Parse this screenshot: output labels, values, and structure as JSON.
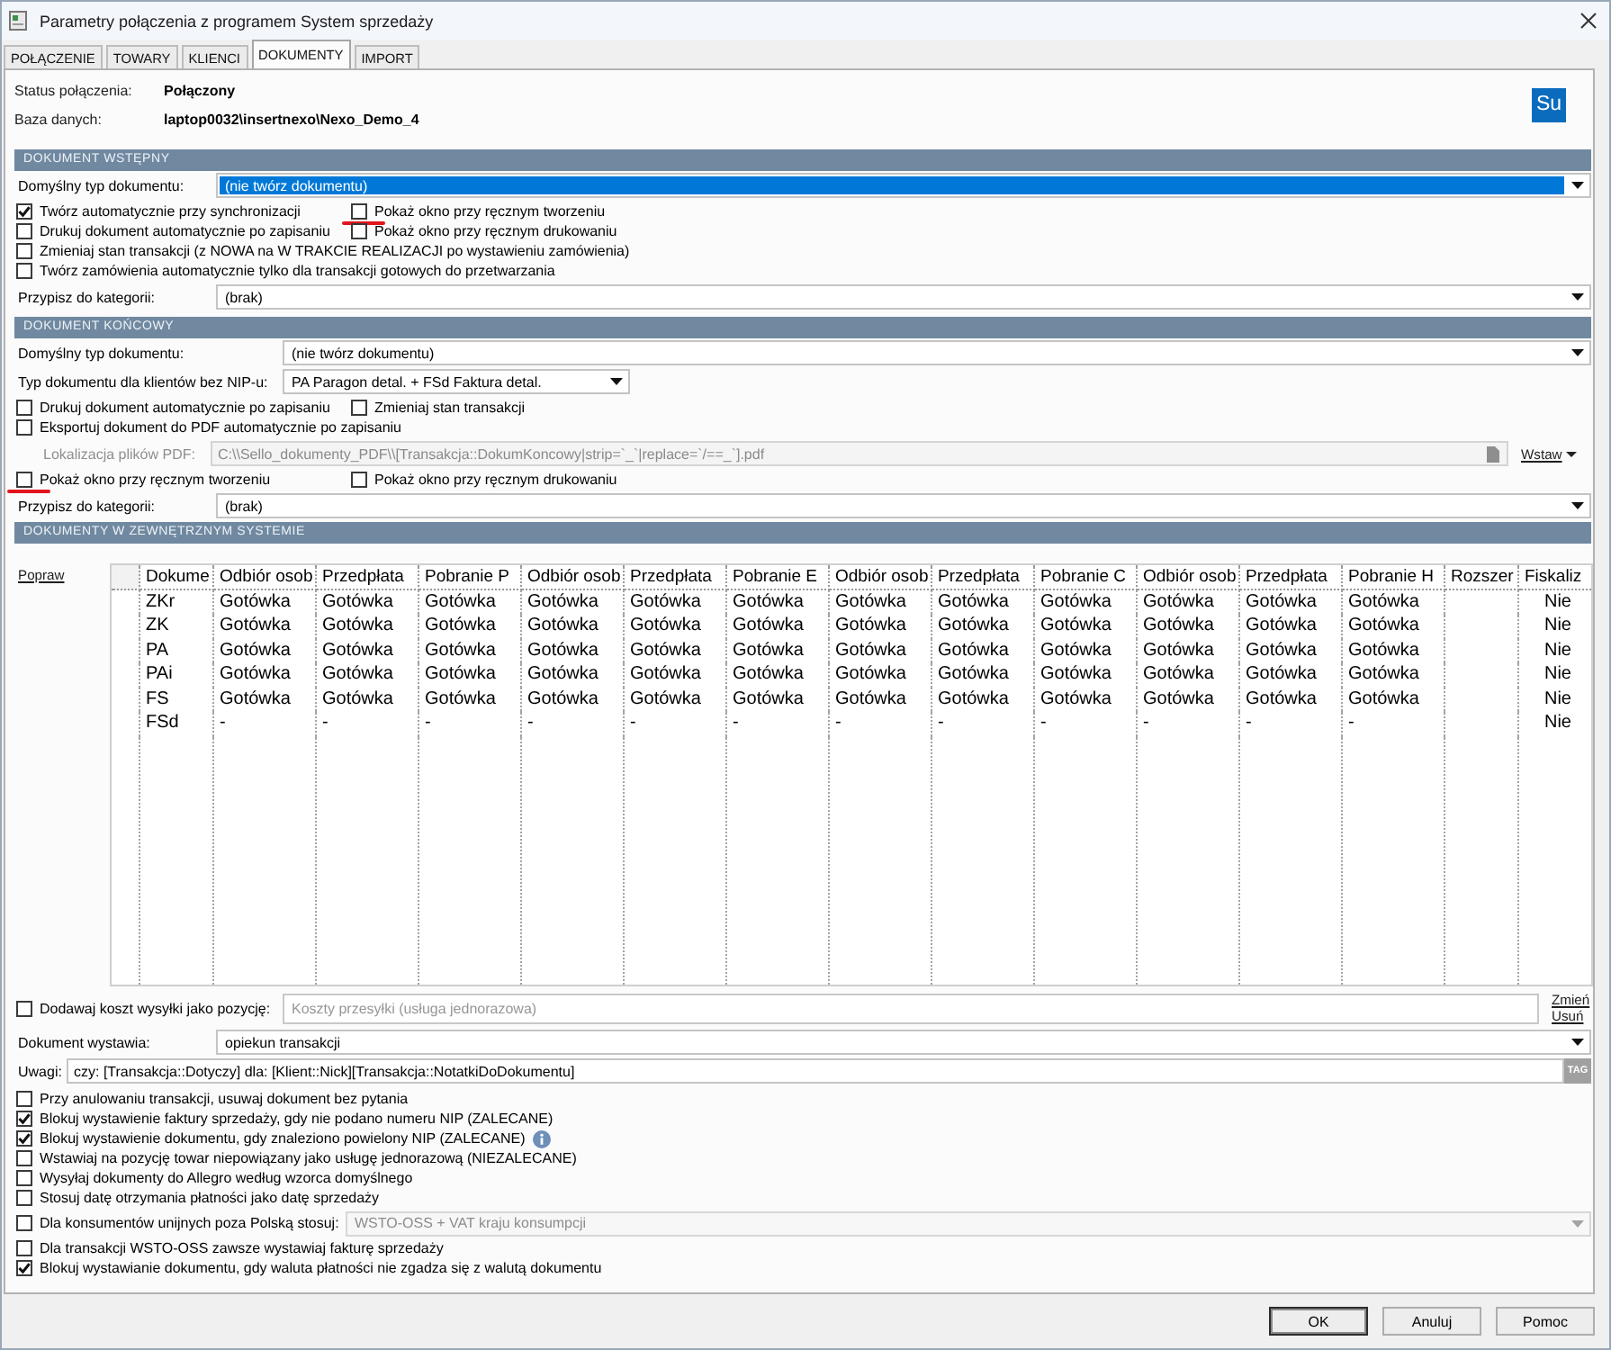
{
  "window": {
    "title": "Parametry połączenia z programem System sprzedaży"
  },
  "tabs": [
    {
      "label": "POŁĄCZENIE",
      "selected": false
    },
    {
      "label": "TOWARY",
      "selected": false
    },
    {
      "label": "KLIENCI",
      "selected": false
    },
    {
      "label": "DOKUMENTY",
      "selected": true
    },
    {
      "label": "IMPORT",
      "selected": false
    }
  ],
  "status": [
    {
      "label": "Status połączenia:",
      "value": "Połączony"
    },
    {
      "label": "Baza danych:",
      "value": "laptop0032\\insertnexo\\Nexo_Demo_4"
    }
  ],
  "logo": {
    "text": "Su"
  },
  "sections": [
    {
      "title": "DOKUMENT WSTĘPNY",
      "rows": [
        {
          "kind": "select",
          "label": "Domyślny typ dokumentu:",
          "value": "(nie twórz dokumentu)",
          "focused": true
        },
        {
          "kind": "checks",
          "items": [
            {
              "label": "Twórz automatycznie przy synchronizacji",
              "checked": true,
              "annotated": false
            },
            {
              "label": "Pokaż okno przy ręcznym tworzeniu",
              "checked": false,
              "annotated": true
            }
          ]
        },
        {
          "kind": "checks",
          "items": [
            {
              "label": "Drukuj dokument automatycznie po zapisaniu",
              "checked": false,
              "annotated": false
            },
            {
              "label": "Pokaż okno przy ręcznym drukowaniu",
              "checked": false,
              "annotated": false
            }
          ]
        },
        {
          "kind": "checks",
          "items": [
            {
              "label": "Zmieniaj stan transakcji (z NOWA na W TRAKCIE REALIZACJI po wystawieniu zamówienia)",
              "checked": false,
              "annotated": false
            }
          ]
        },
        {
          "kind": "checks",
          "items": [
            {
              "label": "Twórz zamówienia automatycznie tylko dla transakcji gotowych do przetwarzania",
              "checked": false,
              "annotated": false
            }
          ]
        },
        {
          "kind": "select",
          "label": "Przypisz do kategorii:",
          "value": "(brak)",
          "focused": false
        }
      ]
    },
    {
      "title": "DOKUMENT KOŃCOWY",
      "rows": [
        {
          "kind": "select_pair",
          "selects": [
            {
              "label": "Domyślny typ dokumentu:",
              "value": "(nie twórz dokumentu)",
              "focused": false
            },
            {
              "label": "Typ dokumentu dla klientów bez NIP-u:",
              "value": "PA Paragon detal. + FSd Faktura detal.",
              "focused": false
            }
          ]
        },
        {
          "kind": "checks",
          "items": [
            {
              "label": "Drukuj dokument automatycznie po zapisaniu",
              "checked": false,
              "annotated": false
            },
            {
              "label": "Zmieniaj stan transakcji",
              "checked": false,
              "annotated": false
            }
          ]
        },
        {
          "kind": "checks",
          "items": [
            {
              "label": "Eksportuj dokument do PDF automatycznie po zapisaniu",
              "checked": false,
              "annotated": false
            }
          ]
        },
        {
          "kind": "path",
          "label": "Lokalizacja plików PDF:",
          "value": "C:\\\\Sello_dokumenty_PDF\\\\[Transakcja::DokumKoncowy|strip=`_`|replace=`/==_`].pdf",
          "disabled": true,
          "link": "Wstaw"
        },
        {
          "kind": "checks",
          "items": [
            {
              "label": "Pokaż okno przy ręcznym tworzeniu",
              "checked": false,
              "annotated": true
            },
            {
              "label": "Pokaż okno przy ręcznym drukowaniu",
              "checked": false,
              "annotated": false
            }
          ]
        },
        {
          "kind": "select",
          "label": "Przypisz do kategorii:",
          "value": "(brak)",
          "focused": false
        }
      ]
    }
  ],
  "external_documents": {
    "title": "DOKUMENTY W ZEWNĘTRZNYM SYSTEMIE",
    "link": "Popraw",
    "table": {
      "columns": [
        "Dokume",
        "Odbiór osob",
        "Przedpłata",
        "Pobranie P",
        "Odbiór osob",
        "Przedpłata",
        "Pobranie E",
        "Odbiór osob",
        "Przedpłata",
        "Pobranie C",
        "Odbiór osob",
        "Przedpłata",
        "Pobranie H",
        "Rozszer",
        "Fiskaliz"
      ],
      "rows": [
        {
          "document": "ZKr",
          "payments": [
            "Gotówka",
            "Gotówka",
            "Gotówka",
            "Gotówka",
            "Gotówka",
            "Gotówka",
            "Gotówka",
            "Gotówka",
            "Gotówka",
            "Gotówka",
            "Gotówka",
            "Gotówka"
          ],
          "fiscal": "Nie"
        },
        {
          "document": "ZK",
          "payments": [
            "Gotówka",
            "Gotówka",
            "Gotówka",
            "Gotówka",
            "Gotówka",
            "Gotówka",
            "Gotówka",
            "Gotówka",
            "Gotówka",
            "Gotówka",
            "Gotówka",
            "Gotówka"
          ],
          "fiscal": "Nie"
        },
        {
          "document": "PA",
          "payments": [
            "Gotówka",
            "Gotówka",
            "Gotówka",
            "Gotówka",
            "Gotówka",
            "Gotówka",
            "Gotówka",
            "Gotówka",
            "Gotówka",
            "Gotówka",
            "Gotówka",
            "Gotówka"
          ],
          "fiscal": "Nie"
        },
        {
          "document": "PAi",
          "payments": [
            "Gotówka",
            "Gotówka",
            "Gotówka",
            "Gotówka",
            "Gotówka",
            "Gotówka",
            "Gotówka",
            "Gotówka",
            "Gotówka",
            "Gotówka",
            "Gotówka",
            "Gotówka"
          ],
          "fiscal": "Nie"
        },
        {
          "document": "FS",
          "payments": [
            "Gotówka",
            "Gotówka",
            "Gotówka",
            "Gotówka",
            "Gotówka",
            "Gotówka",
            "Gotówka",
            "Gotówka",
            "Gotówka",
            "Gotówka",
            "Gotówka",
            "Gotówka"
          ],
          "fiscal": "Nie"
        },
        {
          "document": "FSd",
          "payments": [
            "-",
            "-",
            "-",
            "-",
            "-",
            "-",
            "-",
            "-",
            "-",
            "-",
            "-",
            "-"
          ],
          "fiscal": "Nie"
        }
      ]
    }
  },
  "shipping": {
    "label": "Dodawaj koszt wysyłki jako pozycję:",
    "checked": false,
    "placeholder": "Koszty przesyłki (usługa jednorazowa)",
    "links": [
      "Zmień",
      "Usuń"
    ]
  },
  "issuer": {
    "label": "Dokument wystawia:",
    "value": "opiekun transakcji",
    "focused": false
  },
  "notes": {
    "label": "Uwagi:",
    "value": "czy: [Transakcja::Dotyczy] dla: [Klient::Nick][Transakcja::NotatkiDoDokumentu]",
    "button": "TAG"
  },
  "options": [
    {
      "kind": "checkbox",
      "label": "Przy anulowaniu transakcji, usuwaj dokument bez pytania",
      "checked": false
    },
    {
      "kind": "checkbox",
      "label": "Blokuj wystawienie faktury sprzedaży, gdy nie podano numeru NIP (ZALECANE)",
      "checked": true
    },
    {
      "kind": "checkbox_info",
      "label": "Blokuj wystawienie dokumentu, gdy znaleziono powielony NIP (ZALECANE)",
      "checked": true
    },
    {
      "kind": "checkbox",
      "label": "Wstawiaj na pozycję towar niepowiązany jako usługę jednorazową (NIEZALECANE)",
      "checked": false
    },
    {
      "kind": "checkbox",
      "label": "Wysyłaj dokumenty do Allegro według wzorca domyślnego",
      "checked": false
    },
    {
      "kind": "checkbox",
      "label": "Stosuj datę otrzymania płatności jako datę sprzedaży",
      "checked": false
    },
    {
      "kind": "checkbox_select",
      "label": "Dla konsumentów unijnych poza Polską stosuj:",
      "checked": false,
      "value": "WSTO-OSS + VAT kraju konsumpcji",
      "disabled": true
    },
    {
      "kind": "checkbox",
      "label": "Dla transakcji WSTO-OSS zawsze wystawiaj fakturę sprzedaży",
      "checked": false
    },
    {
      "kind": "checkbox",
      "label": "Blokuj wystawianie dokumentu, gdy waluta płatności nie zgadza się z walutą dokumentu",
      "checked": true
    }
  ],
  "buttons": [
    {
      "label": "OK",
      "default": true
    },
    {
      "label": "Anuluj",
      "default": false
    },
    {
      "label": "Pomoc",
      "default": false
    }
  ]
}
